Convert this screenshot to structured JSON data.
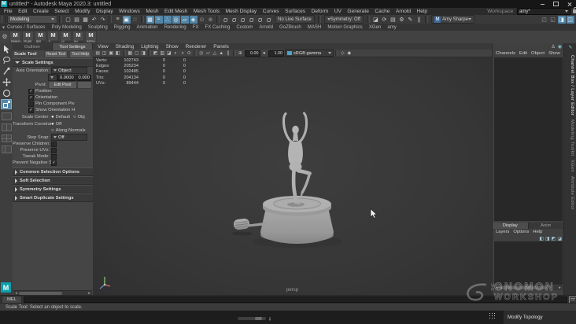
{
  "app": {
    "logo_letter": "M",
    "title": "untitled* - Autodesk Maya 2020.3: untitled"
  },
  "menu_bar": {
    "items": [
      "File",
      "Edit",
      "Create",
      "Select",
      "Modify",
      "Display",
      "Windows",
      "Mesh",
      "Edit Mesh",
      "Mesh Tools",
      "Mesh Display",
      "Curves",
      "Surfaces",
      "Deform",
      "UV",
      "Generate",
      "Cache",
      "Arnold",
      "Help"
    ],
    "workspace_label": "Workspace:",
    "workspace_value": "amy*"
  },
  "status_line": {
    "menuset": "Modeling",
    "no_live_surface": "No Live Surface",
    "symmetry": "Symmetry: Off",
    "user_name": "Amy Sharpe"
  },
  "glyphs": {
    "new": "▢",
    "open": "▤",
    "save": "▦",
    "undo": "↶",
    "redo": "↷",
    "hier": "≡",
    "obj": "▣",
    "comp": "∷",
    "snap_grid": "▦",
    "snap_curve": "≈",
    "snap_point": "∴",
    "snap_center": "◎",
    "snap_plane": "▱",
    "make_live": "◈",
    "lock": "⊙",
    "counter": "⊕",
    "magnet": "Ω",
    "clapper": "◪",
    "ipr": "⟳",
    "gear": "⚙",
    "seq": "▤",
    "pfx": "✎",
    "pause": "∥",
    "tog1": "◰",
    "tog2": "◱",
    "tog3": "◨",
    "tog4": "◫",
    "person": "♙",
    "sphere": "◉",
    "pencil": "✎",
    "l1": "◧",
    "l2": "◨",
    "l3": "◩",
    "l4": "◪",
    "tri_l": "◂",
    "tri_r": "▸",
    "collapse": "▾",
    "list": "☰"
  },
  "shelf": {
    "tabs": [
      "Curves / Surfaces",
      "Poly Modeling",
      "Sculpting",
      "Rigging",
      "Animation",
      "Rendering",
      "FX",
      "FX Caching",
      "Custom",
      "Arnold",
      "GoZBrush",
      "MASH",
      "Motion Graphics",
      "XGen",
      "amy"
    ],
    "buttons": [
      {
        "glyph": "M",
        "label": "swaBox"
      },
      {
        "glyph": "M",
        "label": "intSplit"
      },
      {
        "glyph": "M",
        "label": "split"
      },
      {
        "glyph": "M",
        "label": "fT"
      },
      {
        "glyph": "M",
        "label": "CP"
      },
      {
        "glyph": "M",
        "label": "DH"
      },
      {
        "glyph": "M",
        "label": "NameS"
      }
    ]
  },
  "tool_settings": {
    "tab_outliner": "Outliner",
    "tab_tool_settings": "Tool Settings",
    "tool_name": "Scale Tool",
    "reset_button": "Reset Tool",
    "help_button": "Tool Help",
    "scale_settings_header": "Scale Settings",
    "axis_orientation_label": "Axis Orientation:",
    "axis_orientation_value": "Object",
    "scale_x": "0.0000",
    "scale_y": "0.000",
    "pivot_label": "Pivot:",
    "edit_pivot_button": "Edit Pivot",
    "pivot_options": [
      {
        "state": "✓",
        "label": "Position"
      },
      {
        "state": "✓",
        "label": "Orientation"
      },
      {
        "state": "",
        "label": "Pin Component Piv"
      },
      {
        "state": "✓",
        "label": "Show Orientation H"
      }
    ],
    "scale_center_label": "Scale Center:",
    "scale_center_options": [
      {
        "state": "●",
        "label": "Default"
      },
      {
        "state": "○",
        "label": "Obj"
      }
    ],
    "transform_constraint_label": "Transform Constraint:",
    "transform_constraint_options": [
      {
        "state": "●",
        "label": "Off"
      },
      {
        "state": "○",
        "label": "Along Normals"
      }
    ],
    "step_snap_label": "Step Snap:",
    "step_snap_value": "Off",
    "checkbox_rows": [
      {
        "label": "Preserve Children:",
        "state": ""
      },
      {
        "label": "Preserve UVs:",
        "state": ""
      },
      {
        "label": "Tweak Mode:",
        "state": ""
      },
      {
        "label": "Prevent Negative Scale:",
        "state": "✓"
      }
    ],
    "collapsed_sections": [
      "Common Selection Options",
      "Soft Selection",
      "Symmetry Settings",
      "Smart Duplicate Settings"
    ]
  },
  "viewport": {
    "menus": [
      "View",
      "Shading",
      "Lighting",
      "Show",
      "Renderer",
      "Panels"
    ],
    "toolbar_glyphs": [
      "▤",
      "◫",
      "▣",
      "◧",
      "▦",
      "◻",
      "◨",
      "◩",
      "▥",
      "◪",
      "◐",
      "◑",
      "⊙",
      "◎",
      "▱",
      "△",
      "▲",
      "∥",
      "⊕",
      "●",
      "◇",
      "◆"
    ],
    "exposure_value": "0.00",
    "gamma_value": "1.00",
    "color_space": "sRGB gamma",
    "camera_label": "persp",
    "hud": {
      "rows": [
        {
          "label": "Verts:",
          "total": "102743",
          "c2": "0",
          "c3": "0"
        },
        {
          "label": "Edges:",
          "total": "205234",
          "c2": "0",
          "c3": "0"
        },
        {
          "label": "Faces:",
          "total": "102485",
          "c2": "0",
          "c3": "0"
        },
        {
          "label": "Tris:",
          "total": "204134",
          "c2": "0",
          "c3": "0"
        },
        {
          "label": "UVs:",
          "total": "89444",
          "c2": "0",
          "c3": "0"
        }
      ]
    }
  },
  "channel_box": {
    "menus": [
      "Channels",
      "Edit",
      "Object",
      "Show"
    ]
  },
  "layer_editor": {
    "tabs": [
      "Display",
      "Anim"
    ],
    "menus": [
      "Layers",
      "Options",
      "Help"
    ]
  },
  "right_strip": {
    "tabs": [
      "Channel Box / Layer Editor",
      "Modeling Toolkit",
      "XGen",
      "Attribute Editor"
    ]
  },
  "command_line": {
    "label": "MEL"
  },
  "help_line": {
    "text": "Scale Tool: Select an object to scale."
  },
  "overlay": {
    "watermark_the": "THE",
    "watermark_line1": "GNOMON",
    "watermark_line2": "WORKSHOP",
    "caption": "Modify Topology"
  },
  "colors": {
    "accent_teal": "#5285a6",
    "brand_teal": "#0ba0ad",
    "avatar_blue": "#3a6ea5"
  }
}
